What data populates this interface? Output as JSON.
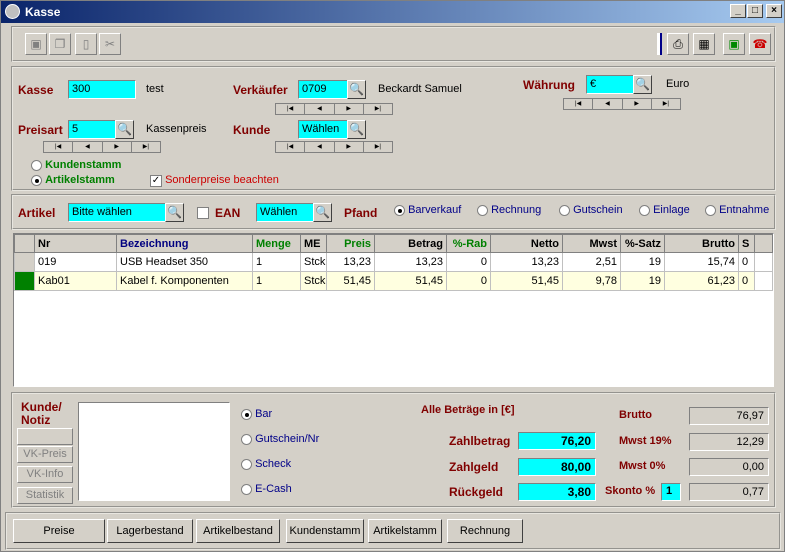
{
  "window": {
    "title": "Kasse",
    "minimize": "_",
    "maximize": "□",
    "close": "×"
  },
  "header": {
    "kasse_label": "Kasse",
    "kasse_value": "300",
    "kasse_name": "test",
    "verkaeufer_label": "Verkäufer",
    "verkaeufer_value": "0709",
    "verkaeufer_name": "Beckardt Samuel",
    "waehrung_label": "Währung",
    "waehrung_value": "€",
    "waehrung_name": "Euro",
    "preisart_label": "Preisart",
    "preisart_value": "5",
    "preisart_name": "Kassenpreis",
    "kunde_label": "Kunde",
    "kunde_value": "Wählen",
    "kundenstamm_label": "Kundenstamm",
    "artikelstamm_label": "Artikelstamm",
    "sonderpreise_label": "Sonderpreise beachten"
  },
  "article_bar": {
    "artikel_label": "Artikel",
    "artikel_value": "Bitte wählen",
    "ean_label": "EAN",
    "pfand_value": "Wählen",
    "pfand_label": "Pfand",
    "modes": [
      "Barverkauf",
      "Rechnung",
      "Gutschein",
      "Einlage",
      "Entnahme"
    ],
    "selected_mode": "Barverkauf"
  },
  "table": {
    "columns": [
      "Nr",
      "Bezeichnung",
      "Menge",
      "ME",
      "Preis",
      "Betrag",
      "%-Rab",
      "Netto",
      "Mwst",
      "%-Satz",
      "Brutto",
      "S"
    ],
    "rows": [
      [
        "019",
        "USB Headset 350",
        "1",
        "Stck",
        "13,23",
        "13,23",
        "0",
        "13,23",
        "2,51",
        "19",
        "15,74",
        "0"
      ],
      [
        "Kab01",
        "Kabel f. Komponenten",
        "1",
        "Stck",
        "51,45",
        "51,45",
        "0",
        "51,45",
        "9,78",
        "19",
        "61,23",
        "0"
      ]
    ]
  },
  "bottom": {
    "notiz_label_1": "Kunde/",
    "notiz_label_2": "Notiz",
    "side_buttons": [
      "",
      "VK-Preis",
      "VK-Info",
      "Statistik"
    ],
    "pay_methods": [
      "Bar",
      "Gutschein/Nr",
      "Scheck",
      "E-Cash"
    ],
    "selected_pay": "Bar",
    "all_amounts": "Alle Beträge in [€]",
    "zahlbetrag_label": "Zahlbetrag",
    "zahlbetrag": "76,20",
    "zahlgeld_label": "Zahlgeld",
    "zahlgeld": "80,00",
    "rueckgeld_label": "Rückgeld",
    "rueckgeld": "3,80",
    "brutto_label": "Brutto",
    "brutto": "76,97",
    "mwst19_label": "Mwst 19%",
    "mwst19": "12,29",
    "mwst0_label": "Mwst 0%",
    "mwst0": "0,00",
    "skonto_label": "Skonto %",
    "skonto_value": "1",
    "skonto": "0,77"
  },
  "footer_buttons": [
    "Preise",
    "Lagerbestand",
    "Artikelbestand",
    "Kundenstamm",
    "Artikelstamm",
    "Rechnung"
  ]
}
